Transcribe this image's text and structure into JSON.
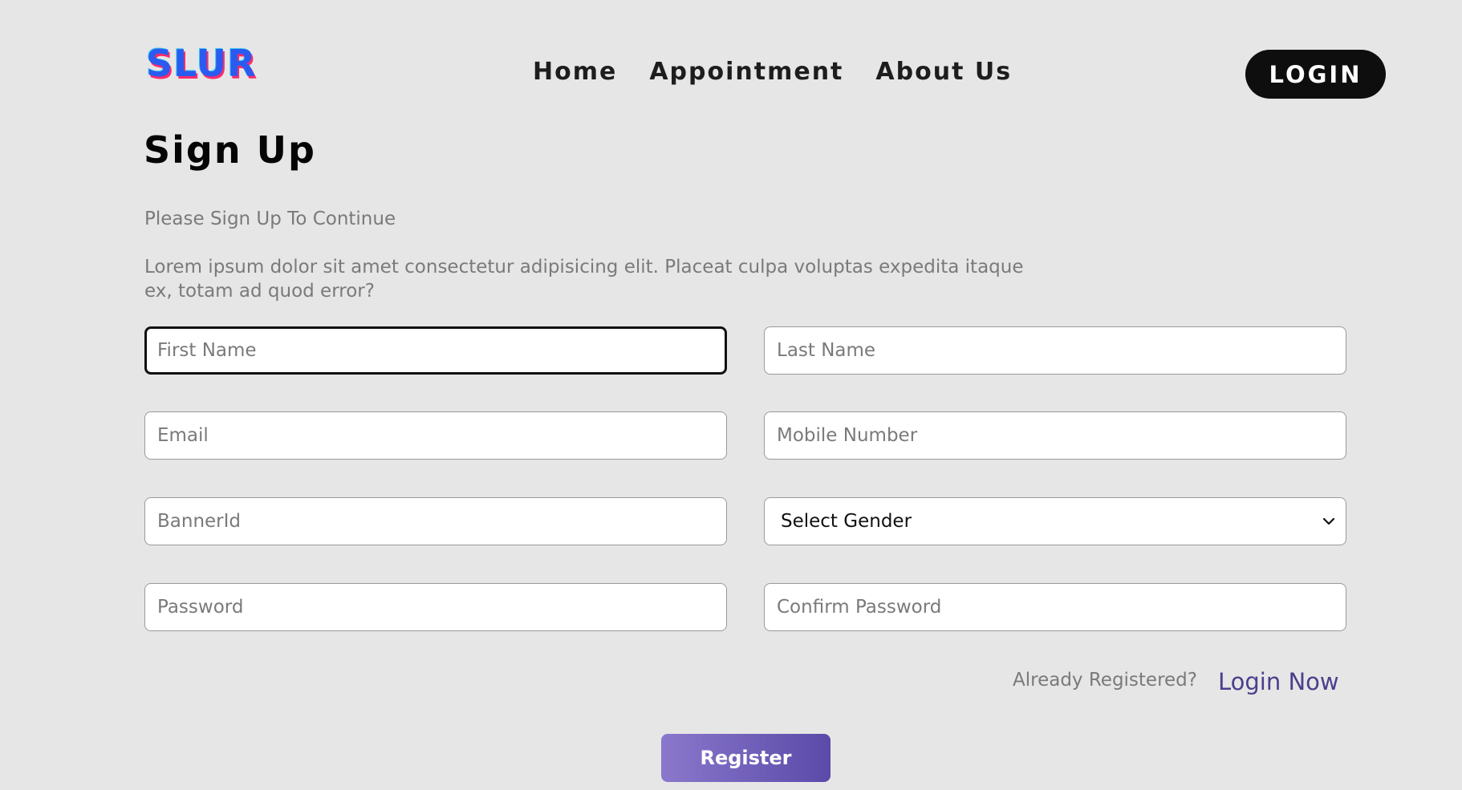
{
  "header": {
    "logo_text": "SLUR",
    "nav": [
      "Home",
      "Appointment",
      "About Us"
    ],
    "login_label": "LOGIN"
  },
  "main": {
    "title": "Sign Up",
    "subtitle": "Please Sign Up To Continue",
    "description": "Lorem ipsum dolor sit amet consectetur adipisicing elit. Placeat culpa voluptas expedita itaque ex, totam ad quod error?"
  },
  "form": {
    "first_name": {
      "placeholder": "First Name",
      "value": ""
    },
    "last_name": {
      "placeholder": "Last Name",
      "value": ""
    },
    "email": {
      "placeholder": "Email",
      "value": ""
    },
    "mobile": {
      "placeholder": "Mobile Number",
      "value": ""
    },
    "banner_id": {
      "placeholder": "BannerId",
      "value": ""
    },
    "gender": {
      "selected": "Select Gender"
    },
    "password": {
      "placeholder": "Password",
      "value": ""
    },
    "confirm_password": {
      "placeholder": "Confirm Password",
      "value": ""
    },
    "already_registered": "Already Registered?",
    "login_now": "Login Now",
    "register_label": "Register"
  },
  "icons": {
    "gender_dropdown": "chevron-down-icon"
  },
  "colors": {
    "background": "#e6e6e6",
    "logo": "#2a5bf0",
    "login_button": "#0e0e0e",
    "link": "#4a3f8c",
    "register_gradient_start": "#8a78cc",
    "register_gradient_end": "#5b4aa8"
  }
}
